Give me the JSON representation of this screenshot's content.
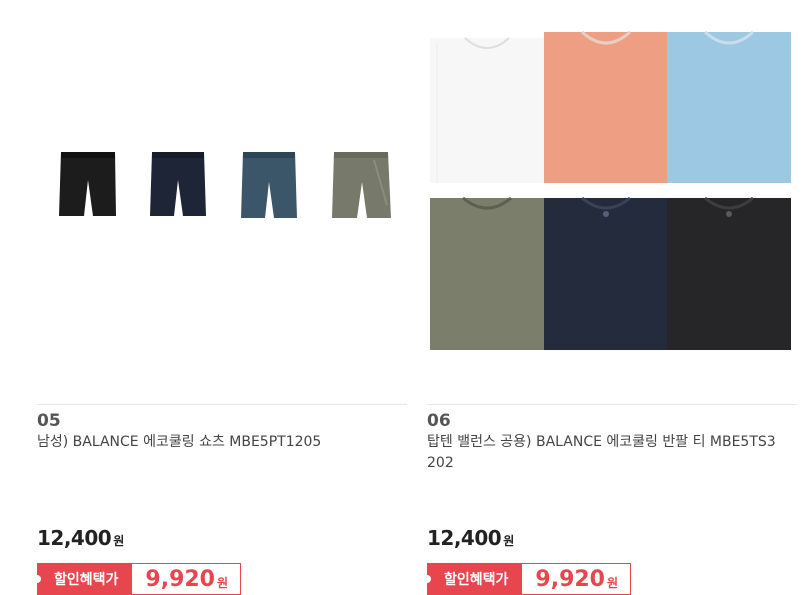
{
  "products": [
    {
      "number": "05",
      "name": "남성) BALANCE 에코쿨링 쇼츠 MBE5PT1205",
      "price": "12,400",
      "currency": "원",
      "sale_label": "할인혜택가",
      "sale_price": "9,920",
      "image": "shorts-four-colors",
      "swatches": [
        "#1c1c1c",
        "#1e2537",
        "#3a5668",
        "#777a6a"
      ]
    },
    {
      "number": "06",
      "name": "탑텐 밸런스 공용) BALANCE 에코쿨링 반팔 티 MBE5TS3202",
      "price": "12,400",
      "currency": "원",
      "sale_label": "할인혜택가",
      "sale_price": "9,920",
      "image": "tshirt-six-colors",
      "swatches": [
        "#f7f7f7",
        "#ee9f83",
        "#9dc8e3",
        "#7c7e6c",
        "#232b3d",
        "#262628"
      ]
    }
  ],
  "colors": {
    "accent": "#e8464f",
    "divider": "#e6e6e6"
  }
}
